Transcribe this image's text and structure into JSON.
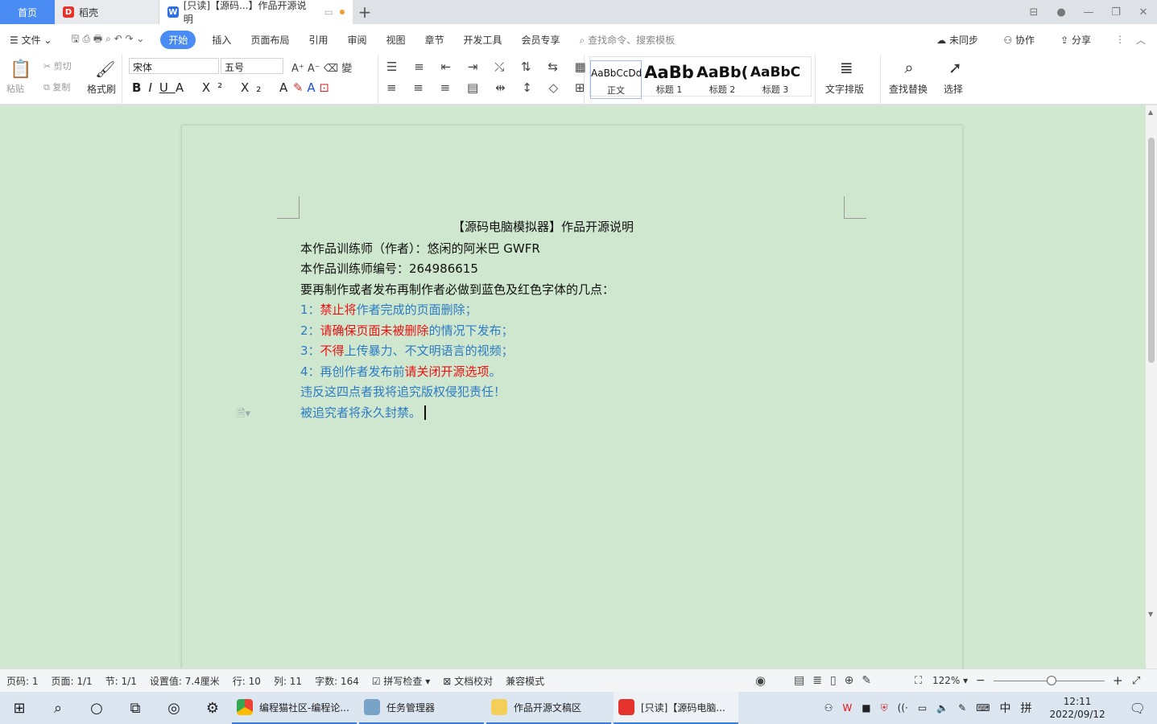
{
  "tabs": {
    "home": "首页",
    "daoke": "稻壳",
    "doc": "[只读]【源码...】作品开源说明",
    "add": "+"
  },
  "menu": {
    "file": "文件",
    "items": [
      "开始",
      "插入",
      "页面布局",
      "引用",
      "审阅",
      "视图",
      "章节",
      "开发工具",
      "会员专享"
    ],
    "search_placeholder": "查找命令、搜索模板",
    "sync": "未同步",
    "collab": "协作",
    "share": "分享"
  },
  "toolbar": {
    "paste": "粘贴",
    "cut": "剪切",
    "copy": "复制",
    "format_painter": "格式刷",
    "font": "宋体",
    "size": "五号",
    "styles": [
      {
        "preview": "AaBbCcDd",
        "label": "正文"
      },
      {
        "preview": "AaBb",
        "label": "标题 1"
      },
      {
        "preview": "AaBb(",
        "label": "标题 2"
      },
      {
        "preview": "AaBbC",
        "label": "标题 3"
      }
    ],
    "text_layout": "文字排版",
    "find_replace": "查找替换",
    "select": "选择"
  },
  "document": {
    "title": "【源码电脑模拟器】作品开源说明",
    "line1": "本作品训练师（作者）：悠闲的阿米巴 GWFR",
    "line2": "本作品训练师编号：264986615",
    "line3": "要再制作或者发布再制作者必做到蓝色及红色字体的几点：",
    "r1a": "1：",
    "r1b": "禁止将",
    "r1c": "作者完成的页面删除；",
    "r2a": "2：",
    "r2b": "请确保页面未被删除",
    "r2c": "的情况下发布；",
    "r3a": "3：",
    "r3b": "不得",
    "r3c": "上传暴力、不文明语言的视频；",
    "r4a": "4：再创作者发布前",
    "r4b": "请关闭开源选项",
    "r4c": "。",
    "line8": "违反这四点者我将追究版权侵犯责任！",
    "line9": "被追究者将永久封禁。"
  },
  "status": {
    "page_code": "页码: 1",
    "page": "页面: 1/1",
    "section": "节: 1/1",
    "setting": "设置值: 7.4厘米",
    "row": "行: 10",
    "col": "列: 11",
    "words": "字数: 164",
    "spell": "拼写检查",
    "proof": "文档校对",
    "compat": "兼容模式",
    "zoom": "122%"
  },
  "taskbar": {
    "apps": [
      "编程猫社区-编程论...",
      "任务管理器",
      "作品开源文稿区",
      "[只读]【源码电脑..."
    ],
    "ime1": "中",
    "ime2": "拼",
    "time": "12:11",
    "date": "2022/09/12"
  },
  "colors": {
    "accent": "#4a8cf4",
    "blue_text": "#2c7bc4",
    "red_text": "#e11111",
    "page_bg": "#cfe7cf"
  }
}
